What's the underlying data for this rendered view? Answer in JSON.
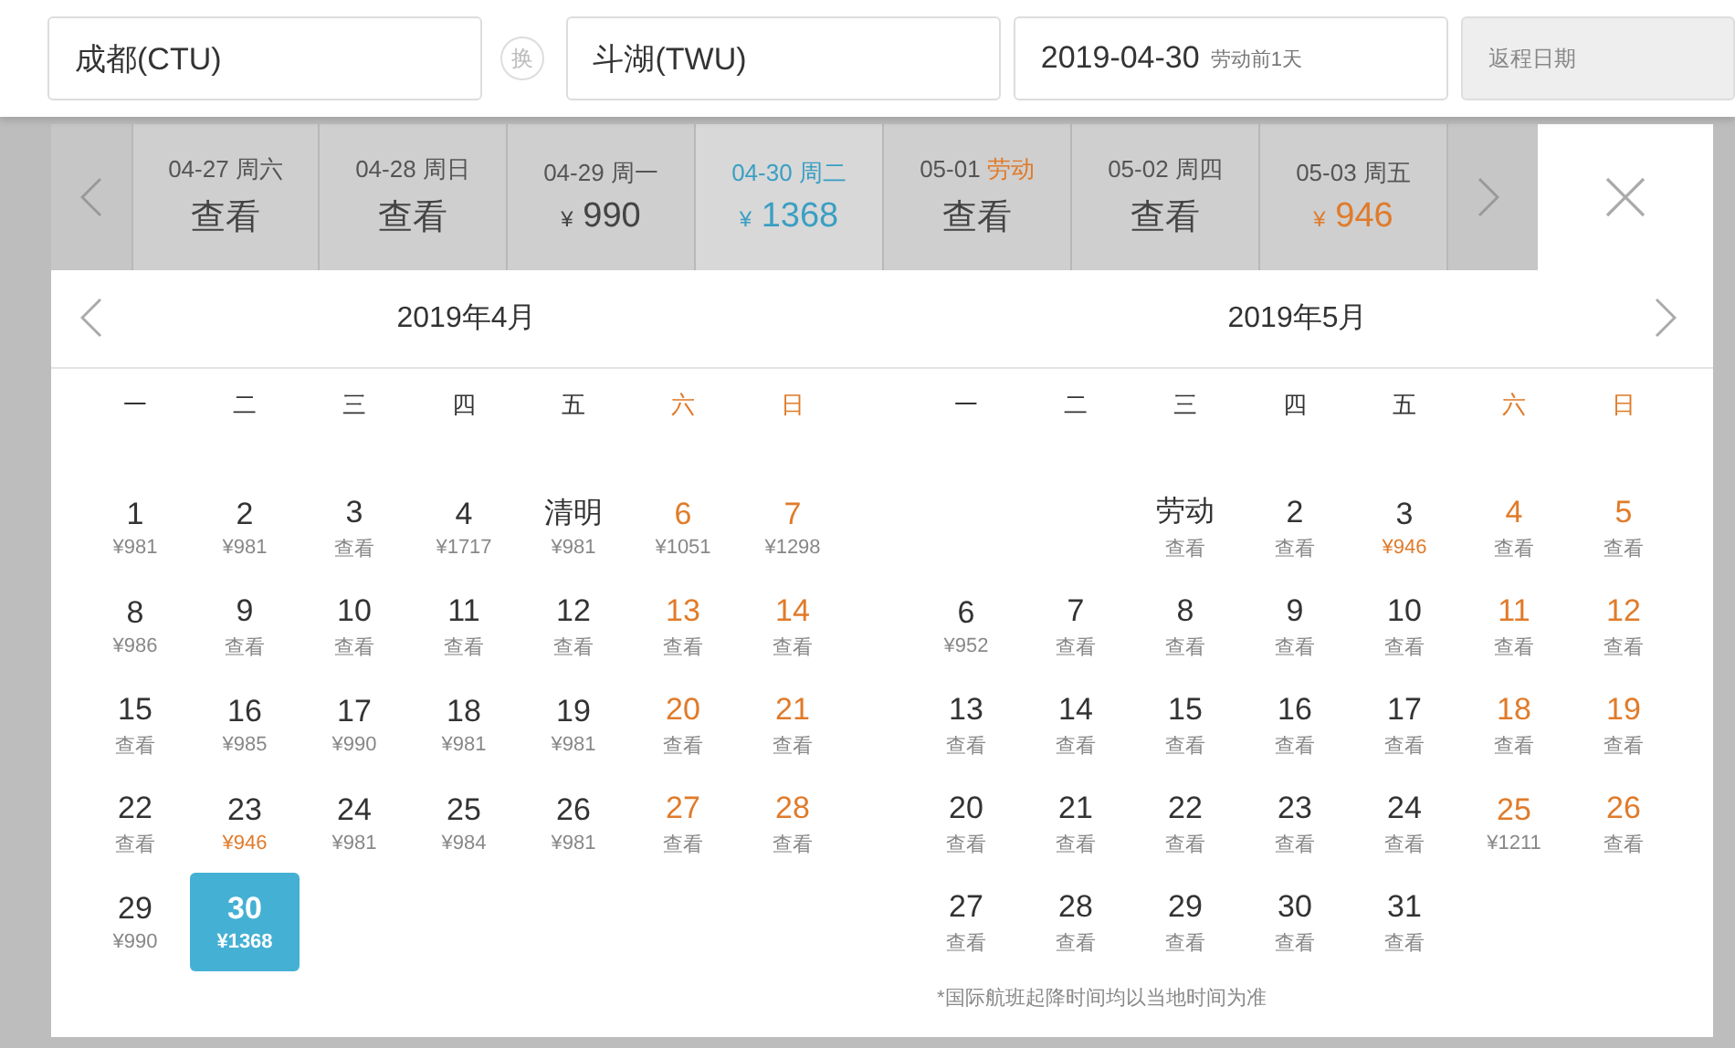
{
  "search": {
    "origin": "成都(CTU)",
    "swap": "换",
    "destination": "斗湖(TWU)",
    "depart_date": "2019-04-30",
    "depart_note": "劳动前1天",
    "return_placeholder": "返程日期"
  },
  "date_strip": [
    {
      "date": "04-27",
      "weekday": "周六",
      "holiday": false,
      "price": "查看",
      "low": false,
      "selected": false
    },
    {
      "date": "04-28",
      "weekday": "周日",
      "holiday": false,
      "price": "查看",
      "low": false,
      "selected": false
    },
    {
      "date": "04-29",
      "weekday": "周一",
      "holiday": false,
      "currency": "¥",
      "price": "990",
      "low": false,
      "selected": false
    },
    {
      "date": "04-30",
      "weekday": "周二",
      "holiday": false,
      "currency": "¥",
      "price": "1368",
      "low": false,
      "selected": true
    },
    {
      "date": "05-01",
      "weekday": "劳动",
      "holiday": true,
      "price": "查看",
      "low": false,
      "selected": false
    },
    {
      "date": "05-02",
      "weekday": "周四",
      "holiday": false,
      "price": "查看",
      "low": false,
      "selected": false
    },
    {
      "date": "05-03",
      "weekday": "周五",
      "holiday": false,
      "currency": "¥",
      "price": "946",
      "low": true,
      "selected": false
    }
  ],
  "months": [
    {
      "title": "2019年4月",
      "weekdays": [
        {
          "label": "一",
          "weekend": false
        },
        {
          "label": "二",
          "weekend": false
        },
        {
          "label": "三",
          "weekend": false
        },
        {
          "label": "四",
          "weekend": false
        },
        {
          "label": "五",
          "weekend": false
        },
        {
          "label": "六",
          "weekend": true
        },
        {
          "label": "日",
          "weekend": true
        }
      ],
      "days": [
        {
          "kind": "day",
          "day": "1",
          "price": "¥981",
          "weekend": false,
          "low": false,
          "selected": false
        },
        {
          "kind": "day",
          "day": "2",
          "price": "¥981",
          "weekend": false,
          "low": false,
          "selected": false
        },
        {
          "kind": "day",
          "day": "3",
          "price": "查看",
          "weekend": false,
          "low": false,
          "selected": false
        },
        {
          "kind": "day",
          "day": "4",
          "price": "¥1717",
          "weekend": false,
          "low": false,
          "selected": false
        },
        {
          "kind": "holiday",
          "day": "清明",
          "price": "¥981",
          "weekend": false,
          "low": false,
          "selected": false
        },
        {
          "kind": "day",
          "day": "6",
          "price": "¥1051",
          "weekend": true,
          "low": false,
          "selected": false
        },
        {
          "kind": "day",
          "day": "7",
          "price": "¥1298",
          "weekend": true,
          "low": false,
          "selected": false
        },
        {
          "kind": "day",
          "day": "8",
          "price": "¥986",
          "weekend": false,
          "low": false,
          "selected": false
        },
        {
          "kind": "day",
          "day": "9",
          "price": "查看",
          "weekend": false,
          "low": false,
          "selected": false
        },
        {
          "kind": "day",
          "day": "10",
          "price": "查看",
          "weekend": false,
          "low": false,
          "selected": false
        },
        {
          "kind": "day",
          "day": "11",
          "price": "查看",
          "weekend": false,
          "low": false,
          "selected": false
        },
        {
          "kind": "day",
          "day": "12",
          "price": "查看",
          "weekend": false,
          "low": false,
          "selected": false
        },
        {
          "kind": "day",
          "day": "13",
          "price": "查看",
          "weekend": true,
          "low": false,
          "selected": false
        },
        {
          "kind": "day",
          "day": "14",
          "price": "查看",
          "weekend": true,
          "low": false,
          "selected": false
        },
        {
          "kind": "day",
          "day": "15",
          "price": "查看",
          "weekend": false,
          "low": false,
          "selected": false
        },
        {
          "kind": "day",
          "day": "16",
          "price": "¥985",
          "weekend": false,
          "low": false,
          "selected": false
        },
        {
          "kind": "day",
          "day": "17",
          "price": "¥990",
          "weekend": false,
          "low": false,
          "selected": false
        },
        {
          "kind": "day",
          "day": "18",
          "price": "¥981",
          "weekend": false,
          "low": false,
          "selected": false
        },
        {
          "kind": "day",
          "day": "19",
          "price": "¥981",
          "weekend": false,
          "low": false,
          "selected": false
        },
        {
          "kind": "day",
          "day": "20",
          "price": "查看",
          "weekend": true,
          "low": false,
          "selected": false
        },
        {
          "kind": "day",
          "day": "21",
          "price": "查看",
          "weekend": true,
          "low": false,
          "selected": false
        },
        {
          "kind": "day",
          "day": "22",
          "price": "查看",
          "weekend": false,
          "low": false,
          "selected": false
        },
        {
          "kind": "day",
          "day": "23",
          "price": "¥946",
          "weekend": false,
          "low": true,
          "selected": false
        },
        {
          "kind": "day",
          "day": "24",
          "price": "¥981",
          "weekend": false,
          "low": false,
          "selected": false
        },
        {
          "kind": "day",
          "day": "25",
          "price": "¥984",
          "weekend": false,
          "low": false,
          "selected": false
        },
        {
          "kind": "day",
          "day": "26",
          "price": "¥981",
          "weekend": false,
          "low": false,
          "selected": false
        },
        {
          "kind": "day",
          "day": "27",
          "price": "查看",
          "weekend": true,
          "low": false,
          "selected": false
        },
        {
          "kind": "day",
          "day": "28",
          "price": "查看",
          "weekend": true,
          "low": false,
          "selected": false
        },
        {
          "kind": "day",
          "day": "29",
          "price": "¥990",
          "weekend": false,
          "low": false,
          "selected": false
        },
        {
          "kind": "day",
          "day": "30",
          "price": "¥1368",
          "weekend": false,
          "low": false,
          "selected": true
        }
      ]
    },
    {
      "title": "2019年5月",
      "weekdays": [
        {
          "label": "一",
          "weekend": false
        },
        {
          "label": "二",
          "weekend": false
        },
        {
          "label": "三",
          "weekend": false
        },
        {
          "label": "四",
          "weekend": false
        },
        {
          "label": "五",
          "weekend": false
        },
        {
          "label": "六",
          "weekend": true
        },
        {
          "label": "日",
          "weekend": true
        }
      ],
      "days": [
        {
          "kind": "blank"
        },
        {
          "kind": "blank"
        },
        {
          "kind": "holiday",
          "day": "劳动",
          "price": "查看",
          "weekend": false,
          "low": false,
          "selected": false
        },
        {
          "kind": "day",
          "day": "2",
          "price": "查看",
          "weekend": false,
          "low": false,
          "selected": false
        },
        {
          "kind": "day",
          "day": "3",
          "price": "¥946",
          "weekend": false,
          "low": true,
          "selected": false
        },
        {
          "kind": "day",
          "day": "4",
          "price": "查看",
          "weekend": true,
          "low": false,
          "selected": false
        },
        {
          "kind": "day",
          "day": "5",
          "price": "查看",
          "weekend": true,
          "low": false,
          "selected": false
        },
        {
          "kind": "day",
          "day": "6",
          "price": "¥952",
          "weekend": false,
          "low": false,
          "selected": false
        },
        {
          "kind": "day",
          "day": "7",
          "price": "查看",
          "weekend": false,
          "low": false,
          "selected": false
        },
        {
          "kind": "day",
          "day": "8",
          "price": "查看",
          "weekend": false,
          "low": false,
          "selected": false
        },
        {
          "kind": "day",
          "day": "9",
          "price": "查看",
          "weekend": false,
          "low": false,
          "selected": false
        },
        {
          "kind": "day",
          "day": "10",
          "price": "查看",
          "weekend": false,
          "low": false,
          "selected": false
        },
        {
          "kind": "day",
          "day": "11",
          "price": "查看",
          "weekend": true,
          "low": false,
          "selected": false
        },
        {
          "kind": "day",
          "day": "12",
          "price": "查看",
          "weekend": true,
          "low": false,
          "selected": false
        },
        {
          "kind": "day",
          "day": "13",
          "price": "查看",
          "weekend": false,
          "low": false,
          "selected": false
        },
        {
          "kind": "day",
          "day": "14",
          "price": "查看",
          "weekend": false,
          "low": false,
          "selected": false
        },
        {
          "kind": "day",
          "day": "15",
          "price": "查看",
          "weekend": false,
          "low": false,
          "selected": false
        },
        {
          "kind": "day",
          "day": "16",
          "price": "查看",
          "weekend": false,
          "low": false,
          "selected": false
        },
        {
          "kind": "day",
          "day": "17",
          "price": "查看",
          "weekend": false,
          "low": false,
          "selected": false
        },
        {
          "kind": "day",
          "day": "18",
          "price": "查看",
          "weekend": true,
          "low": false,
          "selected": false
        },
        {
          "kind": "day",
          "day": "19",
          "price": "查看",
          "weekend": true,
          "low": false,
          "selected": false
        },
        {
          "kind": "day",
          "day": "20",
          "price": "查看",
          "weekend": false,
          "low": false,
          "selected": false
        },
        {
          "kind": "day",
          "day": "21",
          "price": "查看",
          "weekend": false,
          "low": false,
          "selected": false
        },
        {
          "kind": "day",
          "day": "22",
          "price": "查看",
          "weekend": false,
          "low": false,
          "selected": false
        },
        {
          "kind": "day",
          "day": "23",
          "price": "查看",
          "weekend": false,
          "low": false,
          "selected": false
        },
        {
          "kind": "day",
          "day": "24",
          "price": "查看",
          "weekend": false,
          "low": false,
          "selected": false
        },
        {
          "kind": "day",
          "day": "25",
          "price": "¥1211",
          "weekend": true,
          "low": false,
          "selected": false
        },
        {
          "kind": "day",
          "day": "26",
          "price": "查看",
          "weekend": true,
          "low": false,
          "selected": false
        },
        {
          "kind": "day",
          "day": "27",
          "price": "查看",
          "weekend": false,
          "low": false,
          "selected": false
        },
        {
          "kind": "day",
          "day": "28",
          "price": "查看",
          "weekend": false,
          "low": false,
          "selected": false
        },
        {
          "kind": "day",
          "day": "29",
          "price": "查看",
          "weekend": false,
          "low": false,
          "selected": false
        },
        {
          "kind": "day",
          "day": "30",
          "price": "查看",
          "weekend": false,
          "low": false,
          "selected": false
        },
        {
          "kind": "day",
          "day": "31",
          "price": "查看",
          "weekend": false,
          "low": false,
          "selected": false
        }
      ],
      "footnote": "*国际航班起降时间均以当地时间为准"
    }
  ]
}
